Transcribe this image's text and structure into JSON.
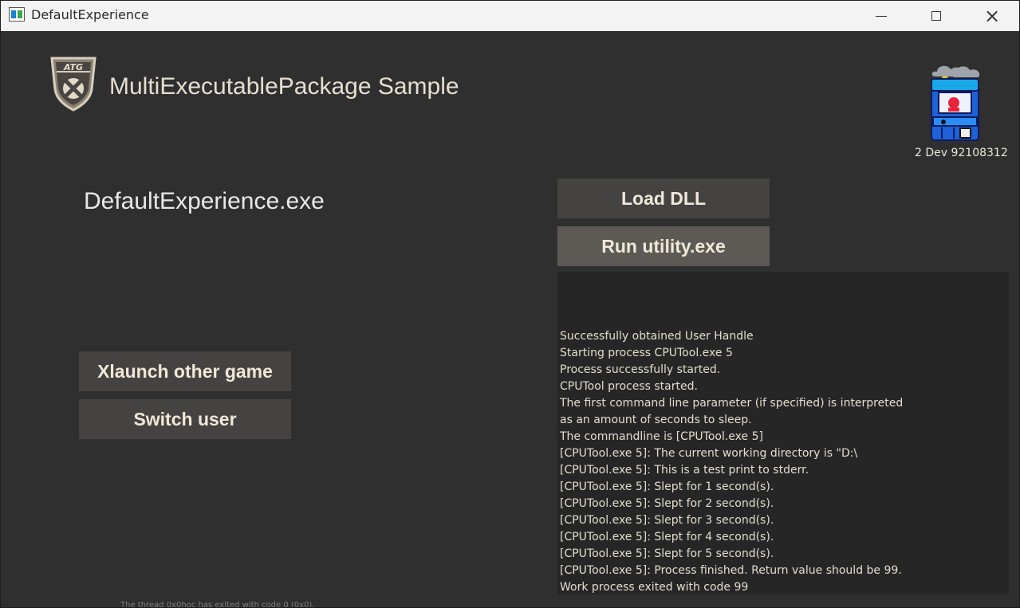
{
  "window": {
    "title": "DefaultExperience",
    "controls": {
      "minimize_icon": "minimize-icon",
      "maximize_icon": "maximize-icon",
      "close_icon": "close-icon"
    }
  },
  "header": {
    "logo_text": "ATG",
    "title": "MultiExecutablePackage Sample"
  },
  "main": {
    "executable_name": "DefaultExperience.exe",
    "buttons": {
      "load_dll": "Load DLL",
      "run_utility": "Run utility.exe",
      "xlaunch": "Xlaunch other game",
      "switch_user": "Switch user"
    }
  },
  "user": {
    "gamertag": "2 Dev 92108312"
  },
  "console": {
    "lines": [
      "Successfully obtained User Handle",
      "Starting process CPUTool.exe 5",
      "Process successfully started.",
      "CPUTool process started.",
      "The first command line parameter (if specified) is interpreted",
      "as an amount of seconds to sleep.",
      "The commandline is [CPUTool.exe 5]",
      "[CPUTool.exe 5]: The current working directory is \"D:\\",
      "[CPUTool.exe 5]: This is a test print to stderr.",
      "[CPUTool.exe 5]: Slept for 1 second(s).",
      "[CPUTool.exe 5]: Slept for 2 second(s).",
      "[CPUTool.exe 5]: Slept for 3 second(s).",
      "[CPUTool.exe 5]: Slept for 4 second(s).",
      "[CPUTool.exe 5]: Slept for 5 second(s).",
      "[CPUTool.exe 5]: Process finished. Return value should be 99.",
      "Work process exited with code 99"
    ]
  },
  "background_output": {
    "clipped_text": "The thread 0x0hoc has exited with code 0 (0x0)."
  },
  "colors": {
    "background": "#2f2f2f",
    "button_dark": "#454341",
    "button_active": "#5d5a55",
    "text": "#efe8d9",
    "console_background": "#262626"
  }
}
